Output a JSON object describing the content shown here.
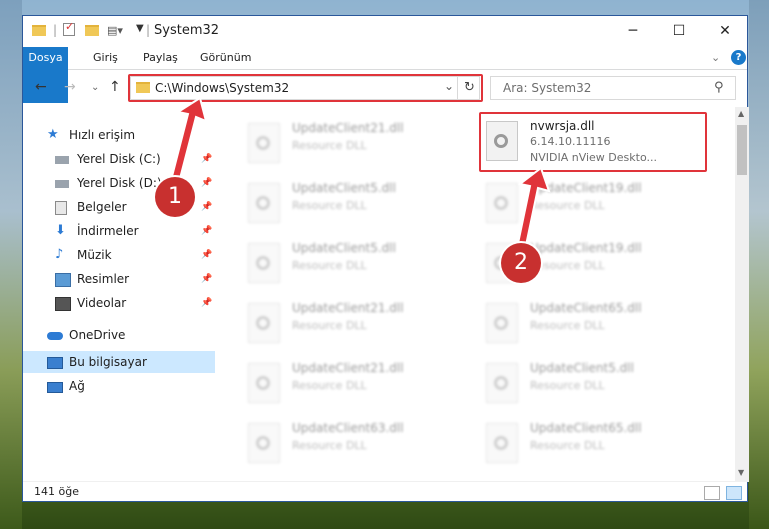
{
  "window": {
    "title": "System32",
    "controls": {
      "minimize": "─",
      "maximize": "☐",
      "close": "✕"
    }
  },
  "ribbon": {
    "tabs": [
      "Dosya",
      "Giriş",
      "Paylaş",
      "Görünüm"
    ],
    "expand": "⌄",
    "help": "?"
  },
  "nav": {
    "back": "←",
    "forward": "→",
    "recent": "⌄",
    "up": "↑",
    "address": "C:\\Windows\\System32",
    "address_dropdown": "⌄",
    "refresh": "↻",
    "search_placeholder": "Ara: System32",
    "search_icon": "⚲"
  },
  "sidebar": {
    "quick_access": "Hızlı erişim",
    "items": [
      {
        "label": "Yerel Disk (C:)",
        "icon": "drive-icon",
        "pinned": true
      },
      {
        "label": "Yerel Disk (D:)",
        "icon": "drive-icon",
        "pinned": true
      },
      {
        "label": "Belgeler",
        "icon": "documents-icon",
        "pinned": true
      },
      {
        "label": "İndirmeler",
        "icon": "downloads-icon",
        "pinned": true
      },
      {
        "label": "Müzik",
        "icon": "music-icon",
        "pinned": true
      },
      {
        "label": "Resimler",
        "icon": "pictures-icon",
        "pinned": true
      },
      {
        "label": "Videolar",
        "icon": "videos-icon",
        "pinned": true
      }
    ],
    "onedrive": "OneDrive",
    "this_pc": "Bu bilgisayar",
    "network": "Ağ"
  },
  "files": {
    "highlighted": {
      "name": "nvwrsja.dll",
      "version": "6.14.10.11116",
      "description": "NVIDIA nView Deskto..."
    },
    "left_column": [
      {
        "name": "UpdateClient21.dll",
        "type": "Resource DLL"
      },
      {
        "name": "UpdateClient5.dll",
        "type": "Resource DLL"
      },
      {
        "name": "UpdateClient5.dll",
        "type": "Resource DLL"
      },
      {
        "name": "UpdateClient21.dll",
        "type": "Resource DLL"
      },
      {
        "name": "UpdateClient21.dll",
        "type": "Resource DLL"
      },
      {
        "name": "UpdateClient63.dll",
        "type": "Resource DLL"
      }
    ],
    "right_column": [
      {
        "name": "UpdateClient19.dll",
        "type": "Resource DLL"
      },
      {
        "name": "UpdateClient19.dll",
        "type": "Resource DLL"
      },
      {
        "name": "UpdateClient65.dll",
        "type": "Resource DLL"
      },
      {
        "name": "UpdateClient5.dll",
        "type": "Resource DLL"
      },
      {
        "name": "UpdateClient65.dll",
        "type": "Resource DLL"
      }
    ]
  },
  "status": {
    "count": "141 öğe"
  },
  "annotations": {
    "step1": "1",
    "step2": "2",
    "color": "#e0343a"
  }
}
